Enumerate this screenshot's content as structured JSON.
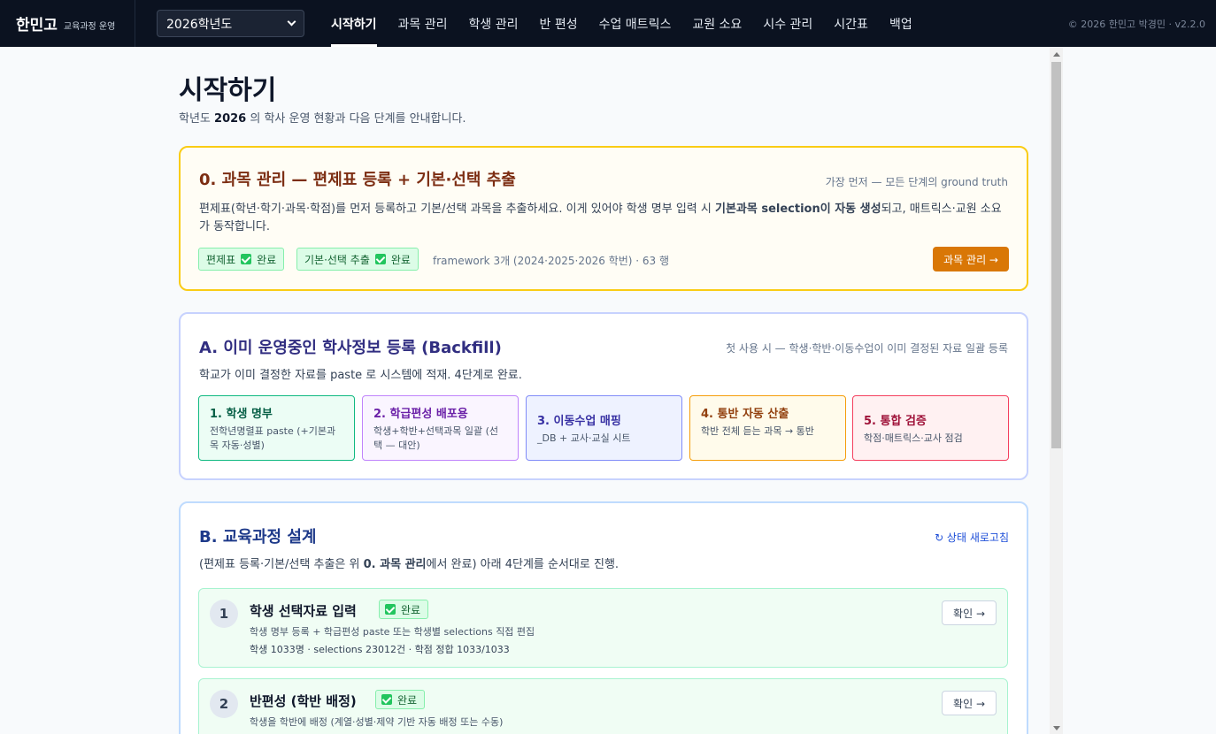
{
  "header": {
    "brand": "한민고",
    "brand_sub": "교육과정 운영",
    "year_select": "2026학년도",
    "nav": [
      "시작하기",
      "과목 관리",
      "학생 관리",
      "반 편성",
      "수업 매트릭스",
      "교원 소요",
      "시수 관리",
      "시간표",
      "백업"
    ],
    "copyright": "© 2026 한민고 박경민 · v2.2.0"
  },
  "page": {
    "title": "시작하기",
    "subtitle_prefix": "학년도",
    "subtitle_year": "2026",
    "subtitle_suffix": "의 학사 운영 현황과 다음 단계를 안내합니다."
  },
  "card0": {
    "title": "0. 과목 관리 — 편제표 등록 + 기본·선택 추출",
    "note": "가장 먼저 — 모든 단계의 ground truth",
    "desc_1": "편제표(학년·학기·과목·학점)를 먼저 등록하고 기본/선택 과목을 추출하세요. 이게 있어야 학생 명부 입력 시",
    "desc_bold": "기본과목 selection이 자동 생성",
    "desc_2": "되고, 매트릭스·교원 소요가 동작합니다.",
    "badge_1": "편제표",
    "badge_2": "기본·선택 추출",
    "badge_status": "완료",
    "meta": "framework 3개 (2024·2025·2026 학번) · 63 행",
    "button": "과목 관리 →"
  },
  "cardA": {
    "title": "A. 이미 운영중인 학사정보 등록 (Backfill)",
    "note": "첫 사용 시 — 학생·학반·이동수업이 이미 결정된 자료 일괄 등록",
    "desc": "학교가 이미 결정한 자료를 paste 로 시스템에 적재. 4단계로 완료.",
    "steps": [
      {
        "title": "1. 학생 명부",
        "desc": "전학년명렬표 paste (+기본과목 자동·성별)"
      },
      {
        "title": "2. 학급편성 배포용",
        "desc": "학생+학반+선택과목 일괄 (선택 — 대안)"
      },
      {
        "title": "3. 이동수업 매핑",
        "desc": "_DB + 교사·교실 시트"
      },
      {
        "title": "4. 통반 자동 산출",
        "desc": "학반 전체 듣는 과목 → 통반"
      },
      {
        "title": "5. 통합 검증",
        "desc": "학점·매트릭스·교사 점검"
      }
    ]
  },
  "cardB": {
    "title": "B. 교육과정 설계",
    "refresh": "↻ 상태 새로고침",
    "desc_1": "(편제표 등록·기본/선택 추출은 위",
    "desc_bold": "0. 과목 관리",
    "desc_2": "에서 완료) 아래 4단계를 순서대로 진행.",
    "tasks": [
      {
        "num": "1",
        "title": "학생 선택자료 입력",
        "status": "완료",
        "desc": "학생 명부 등록 + 학급편성 paste 또는 학생별 selections 직접 편집",
        "meta": "학생 1033명 · selections 23012건 · 학점 정합 1033/1033",
        "button": "확인 →"
      },
      {
        "num": "2",
        "title": "반편성 (학반 배정)",
        "status": "완료",
        "desc": "학생을 학반에 배정 (계열·성별·제약 기반 자동 배정 또는 수동)",
        "meta": "",
        "button": "확인 →"
      }
    ]
  }
}
